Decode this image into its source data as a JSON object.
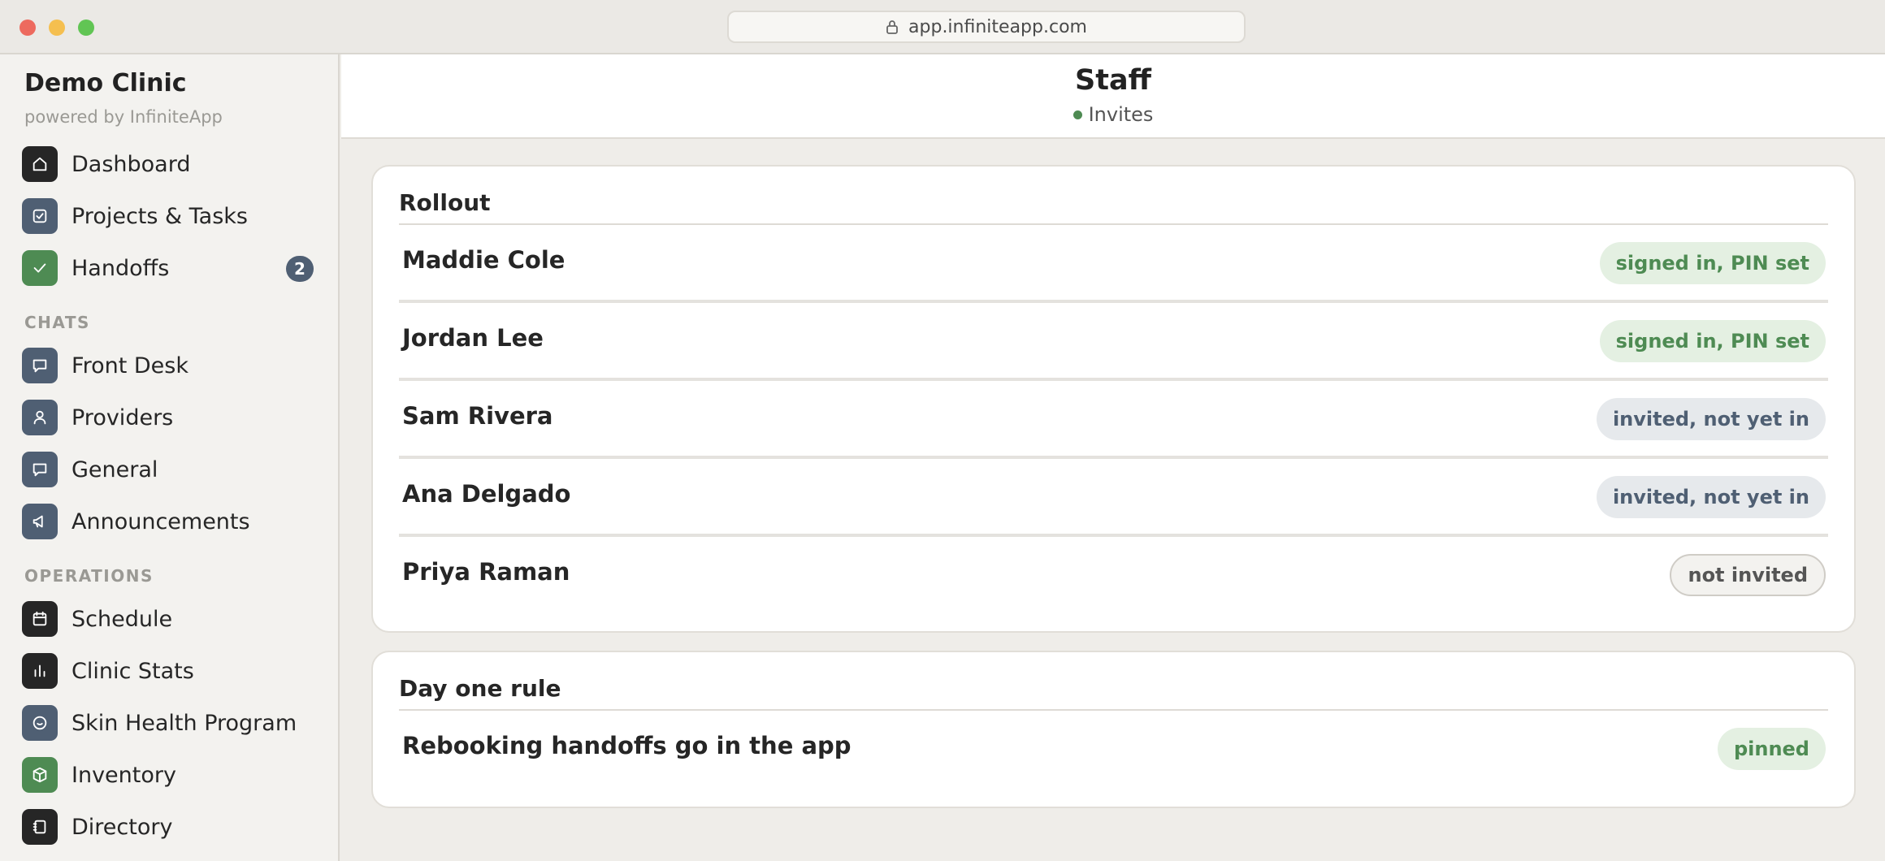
{
  "browser": {
    "url": "app.infiniteapp.com"
  },
  "sidebar": {
    "brand_title": "Demo Clinic",
    "brand_subtitle": "powered by InfiniteApp",
    "top_items": [
      {
        "label": "Dashboard",
        "icon": "home-icon"
      },
      {
        "label": "Projects & Tasks",
        "icon": "checkbox-icon"
      },
      {
        "label": "Handoffs",
        "icon": "check-icon",
        "badge": "2"
      }
    ],
    "chats_label": "CHATS",
    "chat_items": [
      {
        "label": "Front Desk",
        "icon": "chat-bubble-icon"
      },
      {
        "label": "Providers",
        "icon": "person-icon"
      },
      {
        "label": "General",
        "icon": "chat-bubble-icon"
      },
      {
        "label": "Announcements",
        "icon": "megaphone-icon"
      }
    ],
    "operations_label": "OPERATIONS",
    "operation_items": [
      {
        "label": "Schedule",
        "icon": "calendar-icon"
      },
      {
        "label": "Clinic Stats",
        "icon": "bar-chart-icon"
      },
      {
        "label": "Skin Health Program",
        "icon": "smile-icon"
      },
      {
        "label": "Inventory",
        "icon": "box-icon"
      },
      {
        "label": "Directory",
        "icon": "contact-book-icon"
      }
    ]
  },
  "header": {
    "title": "Staff",
    "subtitle": "Invites",
    "status_color": "#4e8b53"
  },
  "rollout": {
    "title": "Rollout",
    "rows": [
      {
        "name": "Maddie Cole",
        "status": "signed in, PIN set"
      },
      {
        "name": "Jordan Lee",
        "status": "signed in, PIN set"
      },
      {
        "name": "Sam Rivera",
        "status": "invited, not yet in"
      },
      {
        "name": "Ana Delgado",
        "status": "invited, not yet in"
      },
      {
        "name": "Priya Raman",
        "status": "not invited"
      }
    ]
  },
  "day_one": {
    "title": "Day one rule",
    "rule": "Rebooking handoffs go in the app",
    "status": "pinned"
  }
}
